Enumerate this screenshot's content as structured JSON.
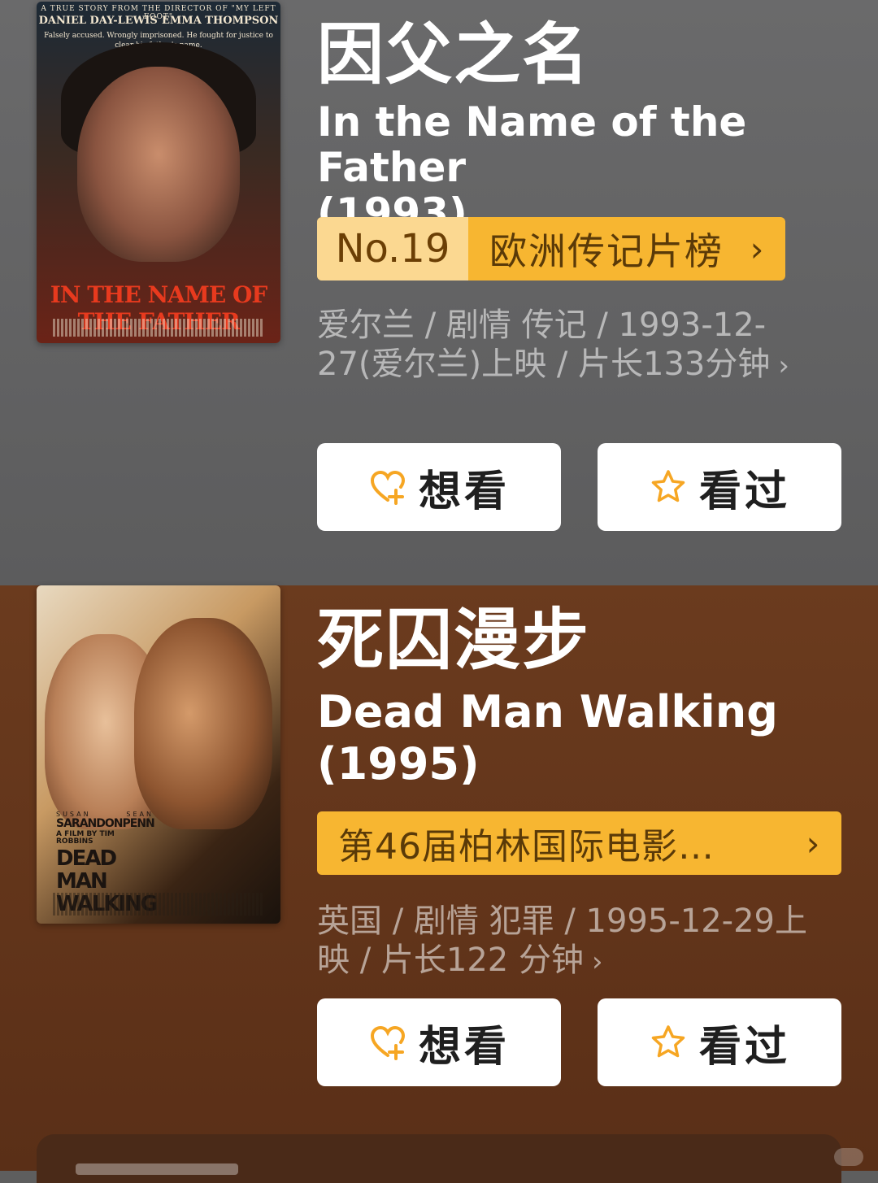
{
  "films": [
    {
      "title_cn": "因父之名",
      "title_en": "In the Name of the Father",
      "year": "(1993)",
      "rank_no": "No.19",
      "rank_label": "欧洲传记片榜",
      "rank_chevron": "›",
      "meta": "爱尔兰 / 剧情 传记 / 1993-12-27(爱尔兰)上映 / 片长133分钟",
      "meta_chevron": "›",
      "want_label": "想看",
      "seen_label": "看过",
      "poster": {
        "tagline_top": "A TRUE STORY FROM THE DIRECTOR OF \"MY LEFT FOOT\"",
        "cast_left": "DANIEL DAY-LEWIS",
        "cast_right": "EMMA THOMPSON",
        "tagline": "Falsely accused. Wrongly imprisoned. He fought for justice to clear his father's name.",
        "title": "IN THE NAME OF THE FATHER"
      }
    },
    {
      "title_cn": "死囚漫步",
      "title_en": "Dead Man Walking",
      "year": "(1995)",
      "rank_label": "第46届柏林国际电影…",
      "rank_chevron": "›",
      "meta": "英国 / 剧情 犯罪 / 1995-12-29上映 / 片长122 分钟",
      "meta_chevron": "›",
      "want_label": "想看",
      "seen_label": "看过",
      "poster": {
        "first_left": "SUSAN",
        "first_right": "SEAN",
        "cast_left": "SARANDON",
        "cast_right": "PENN",
        "by": "A FILM BY TIM ROBBINS",
        "title": "DEAD MAN WALKING"
      }
    }
  ],
  "colors": {
    "card1_bg": "#666667",
    "card2_bg": "#633520",
    "rank_bg": "#f7b631",
    "rank_no_bg": "#fbd891",
    "heart_icon": "#f6a623",
    "star_icon": "#f6a623"
  },
  "icons": {
    "want": "heart-plus-icon",
    "seen": "star-icon"
  }
}
